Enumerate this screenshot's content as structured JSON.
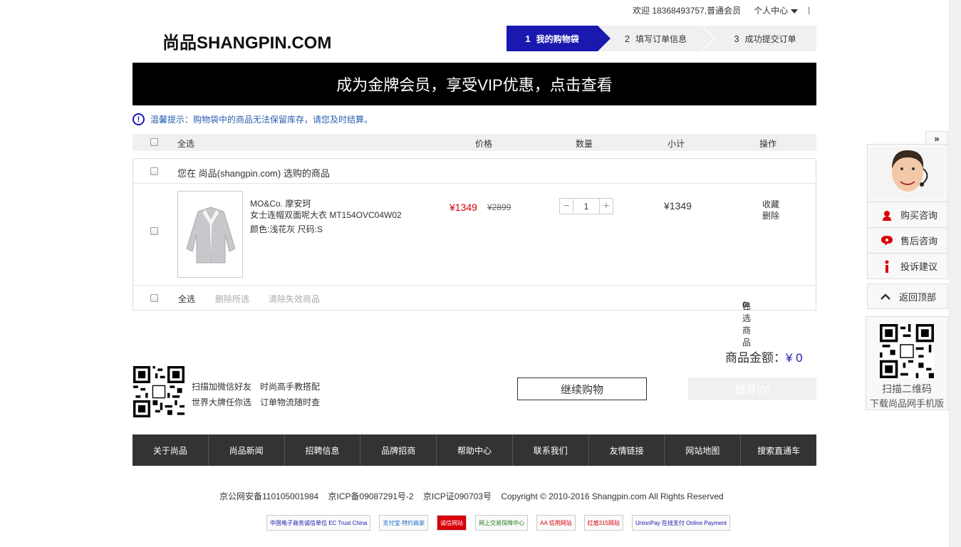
{
  "topbar": {
    "welcome": "欢迎 18368493757,普通会员",
    "user_center": "个人中心",
    "divider": "|"
  },
  "logo": {
    "text": "尚品SHANGPIN.COM"
  },
  "steps": [
    {
      "num": "1",
      "label": "我的购物袋"
    },
    {
      "num": "2",
      "label": "填写订单信息"
    },
    {
      "num": "3",
      "label": "成功提交订单"
    }
  ],
  "banner": {
    "text": "成为金牌会员，享受VIP优惠，点击查看"
  },
  "tip": {
    "icon": "exclamation-circle-icon",
    "text": "温馨提示：购物袋中的商品无法保留库存，请您及时结算。"
  },
  "table_header": {
    "select_all": "全选",
    "price": "价格",
    "quantity": "数量",
    "subtotal": "小计",
    "operation": "操作"
  },
  "shop": {
    "label": "您在 尚品(shangpin.com) 选购的商品"
  },
  "item": {
    "brand": "MO&Co. 摩安珂",
    "name": "女士连帽双面呢大衣 MT154OVC04W02",
    "attrs": "颜色:浅花灰 尺码:S",
    "price_now": "¥1349",
    "price_old": "¥2899",
    "qty_minus": "−",
    "qty_value": "1",
    "qty_plus": "+",
    "subtotal": "¥1349",
    "op_fav": "收藏",
    "op_delete": "删除"
  },
  "cart_footer": {
    "select_all": "全选",
    "delete_selected": "删除所选",
    "clear_invalid": "清除失效商品",
    "selected_count_label": "已选商品",
    "selected_count": "0",
    "selected_unit": "件"
  },
  "amount": {
    "label": "商品金额：",
    "value": "¥ 0"
  },
  "wechat": {
    "line1a": "扫描加微信好友",
    "line1b": "时尚高手教搭配",
    "line2a": "世界大牌任你选",
    "line2b": "订单物流随时查"
  },
  "buttons": {
    "continue": "继续购物",
    "checkout": "结算(0)"
  },
  "footer_nav": [
    "关于尚品",
    "尚品新闻",
    "招聘信息",
    "品牌招商",
    "帮助中心",
    "联系我们",
    "友情链接",
    "网站地图",
    "搜索直通车"
  ],
  "copyright": "京公网安备110105001984    京ICP备09087291号-2    京ICP证090703号    Copyright © 2010-2016 Shangpin.com All Rights Reserved",
  "badges": [
    "中国电子商务诚信单位 EC Trust China",
    "支付宝·特约商家",
    "诚信网站",
    "网上交易保障中心",
    "AA 信用网站",
    "红盾315网站",
    "UnionPay 在线支付 Online Payment"
  ],
  "side": {
    "toggle": "»",
    "items": [
      {
        "icon": "headset-icon",
        "label": "购买咨询"
      },
      {
        "icon": "chat-bubble-icon",
        "label": "售后咨询"
      },
      {
        "icon": "exclamation-icon",
        "label": "投诉建议"
      }
    ],
    "back_top": "返回顶部",
    "qr_line1": "扫描二维码",
    "qr_line2": "下载尚品网手机版"
  },
  "colors": {
    "brand_blue": "#1919b0",
    "price_red": "#d8000a",
    "footer_dark": "#333333"
  }
}
